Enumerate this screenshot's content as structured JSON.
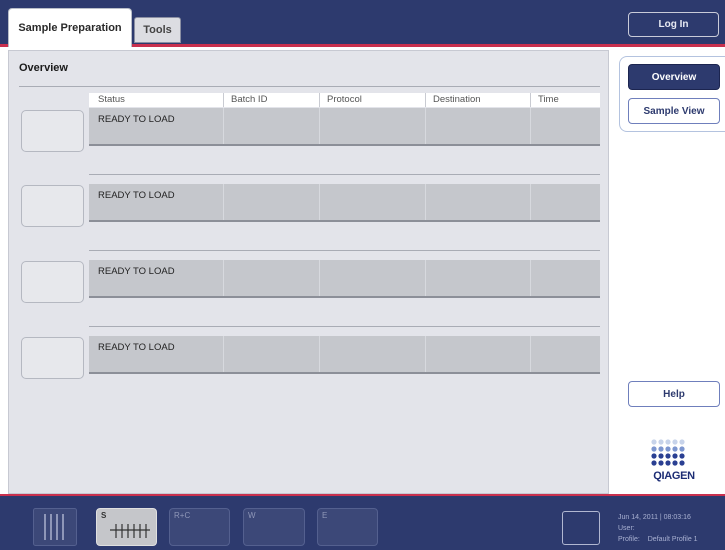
{
  "tabs": [
    {
      "label": "Sample Preparation",
      "active": true
    },
    {
      "label": "Tools",
      "active": false
    }
  ],
  "header": {
    "login_label": "Log In"
  },
  "main": {
    "title": "Overview",
    "columns": [
      "Status",
      "Batch ID",
      "Protocol",
      "Destination",
      "Time"
    ],
    "rows": [
      {
        "status": "READY TO LOAD",
        "batch_id": "",
        "protocol": "",
        "destination": "",
        "time": ""
      },
      {
        "status": "READY TO LOAD",
        "batch_id": "",
        "protocol": "",
        "destination": "",
        "time": ""
      },
      {
        "status": "READY TO LOAD",
        "batch_id": "",
        "protocol": "",
        "destination": "",
        "time": ""
      },
      {
        "status": "READY TO LOAD",
        "batch_id": "",
        "protocol": "",
        "destination": "",
        "time": ""
      }
    ]
  },
  "right_nav": {
    "overview_label": "Overview",
    "sample_view_label": "Sample View",
    "help_label": "Help"
  },
  "logo": {
    "text": "QIAGEN",
    "icon": "qiagen-logo-icon"
  },
  "bottom": {
    "drawers": [
      {
        "label": "S",
        "active": true
      },
      {
        "label": "R+C",
        "active": false
      },
      {
        "label": "W",
        "active": false
      },
      {
        "label": "E",
        "active": false
      }
    ],
    "datetime": "Jun 14, 2011 | 08:03:16",
    "user_label": "User:",
    "user_value": "",
    "profile_label": "Profile:",
    "profile_value": "Default Profile 1"
  },
  "colors": {
    "bar": "#2d3a6e",
    "accent": "#c9304e",
    "panel": "#e3e4ea",
    "row": "#c5c7cc"
  }
}
